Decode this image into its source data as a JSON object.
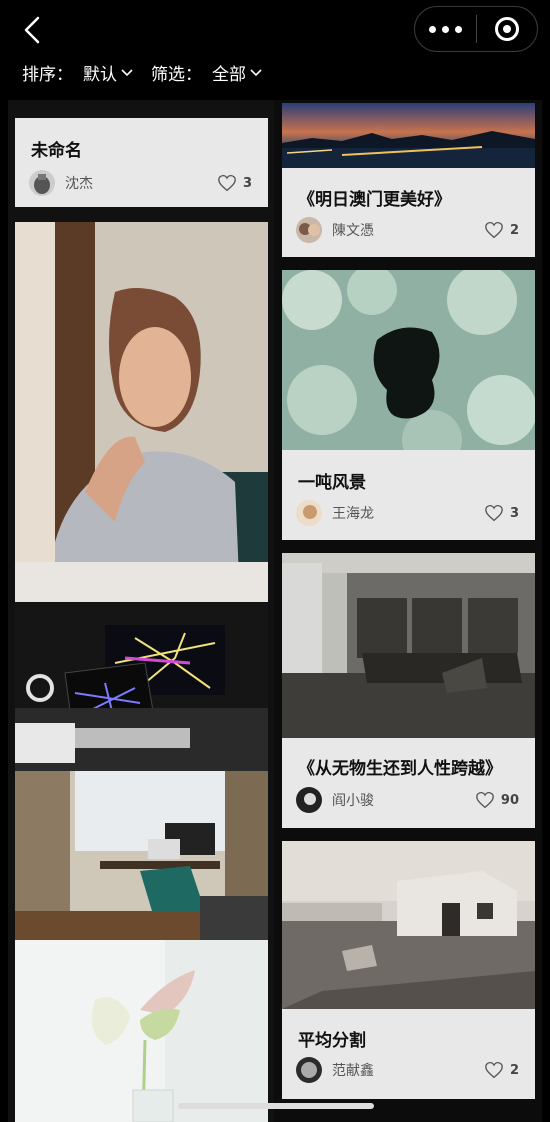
{
  "header": {
    "sort_label": "排序：",
    "sort_value": "默认",
    "filter_label": "筛选：",
    "filter_value": "全部"
  },
  "left_column": [
    {
      "title": "未命名",
      "author": "沈杰",
      "likes": "3"
    }
  ],
  "right_column": [
    {
      "title": "《明日澳门更美好》",
      "author": "陳文憑",
      "likes": "2"
    },
    {
      "title": "一吨风景",
      "author": "王海龙",
      "likes": "3"
    },
    {
      "title": "《从无物生还到人性跨越》",
      "author": "阎小骏",
      "likes": "90"
    },
    {
      "title": "平均分割",
      "author": "范献鑫",
      "likes": "2"
    }
  ],
  "icons": [
    "back-arrow-icon",
    "more-icon",
    "target-icon",
    "chevron-down-icon",
    "heart-icon"
  ]
}
